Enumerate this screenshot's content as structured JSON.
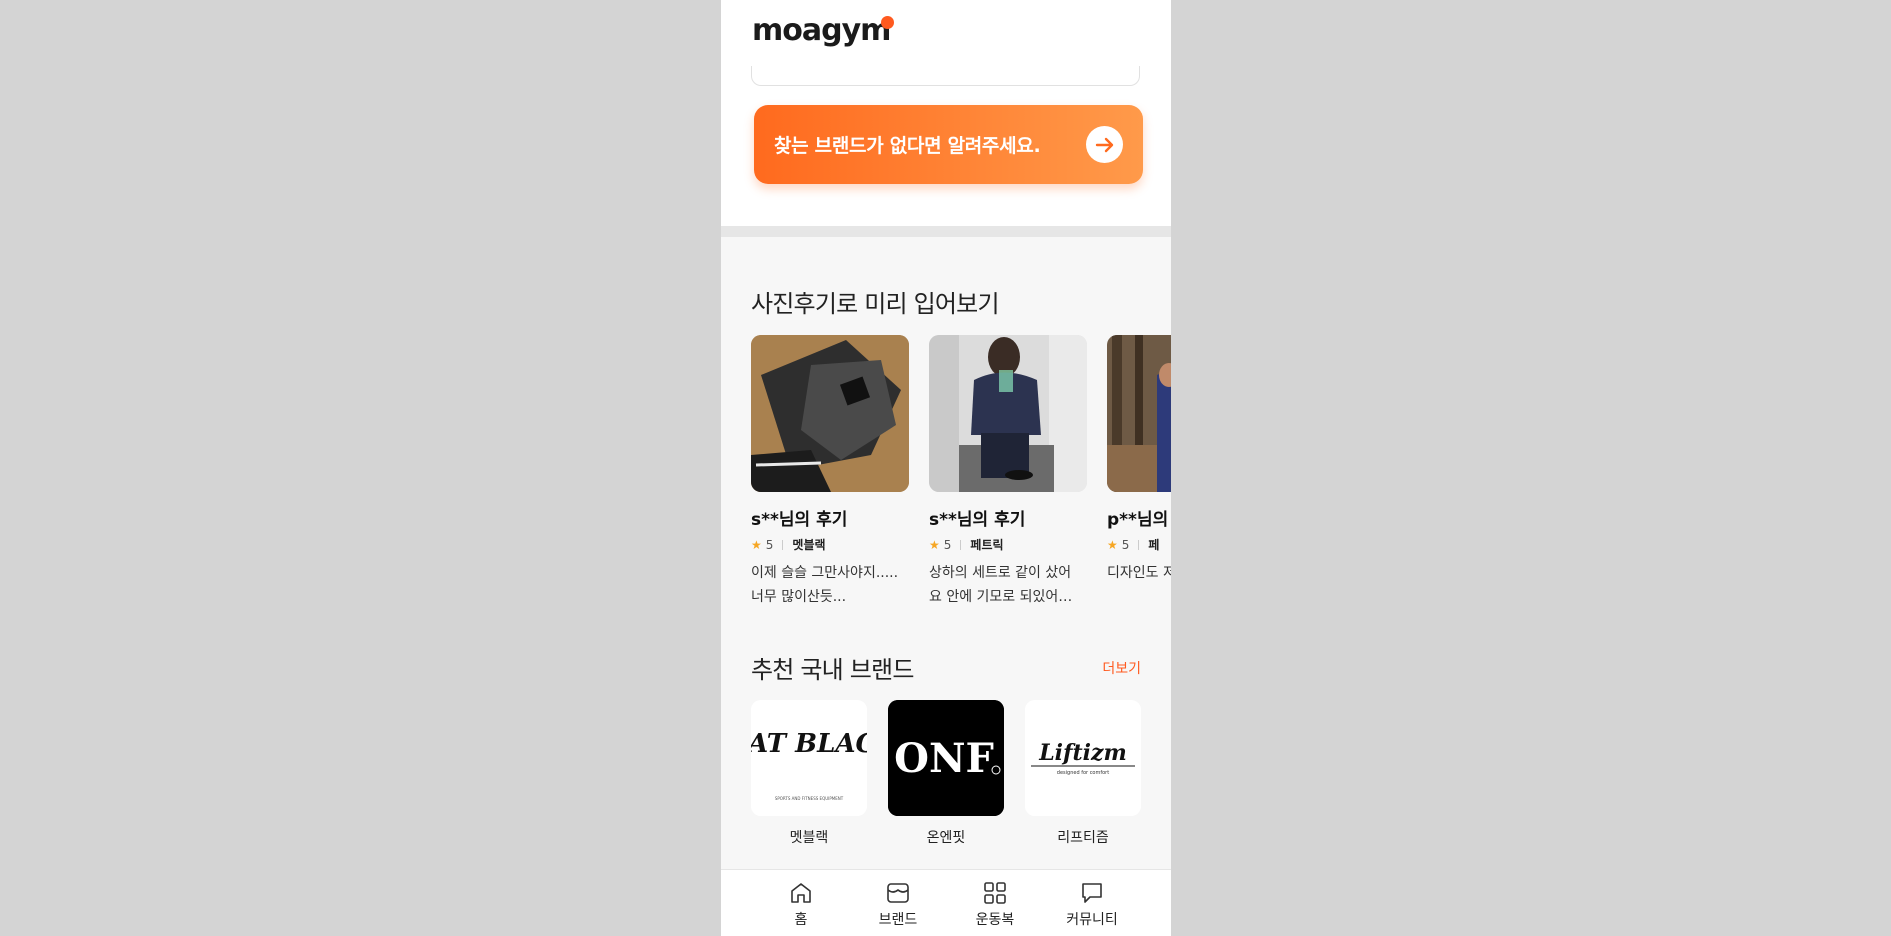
{
  "app": {
    "logo_text": "moagym",
    "brand_color": "#ff5a1f"
  },
  "cta": {
    "label": "찾는 브랜드가 없다면 알려주세요.",
    "icon": "arrow-right-icon"
  },
  "photo_reviews": {
    "title": "사진후기로 미리 입어보기",
    "items": [
      {
        "title": "s**님의 후기",
        "rating": "5",
        "brand": "멧블랙",
        "text": "이제 슬슬 그만사야지..... 너무 많이산듯..."
      },
      {
        "title": "s**님의 후기",
        "rating": "5",
        "brand": "페트릭",
        "text": "상하의 세트로 같이 샀어요 안에 기모로 되있어…"
      },
      {
        "title": "p**님의",
        "rating": "5",
        "brand": "페",
        "text": "디자인도 저 이즈도 딱 맞"
      }
    ]
  },
  "brands": {
    "title": "추천 국내 브랜드",
    "more_label": "더보기",
    "items": [
      {
        "name": "멧블랙",
        "logo": "MAT BLACK",
        "logo_sub": "SPORTS AND FITNESS EQUIPMENT"
      },
      {
        "name": "온엔핏",
        "logo": "ONF"
      },
      {
        "name": "리프티즘",
        "logo": "Liftizm",
        "logo_sub": "designed for comfort"
      }
    ]
  },
  "bottom_nav": [
    {
      "label": "홈",
      "icon": "home-icon"
    },
    {
      "label": "브랜드",
      "icon": "store-icon"
    },
    {
      "label": "운동복",
      "icon": "grid-icon"
    },
    {
      "label": "커뮤니티",
      "icon": "chat-icon"
    }
  ]
}
